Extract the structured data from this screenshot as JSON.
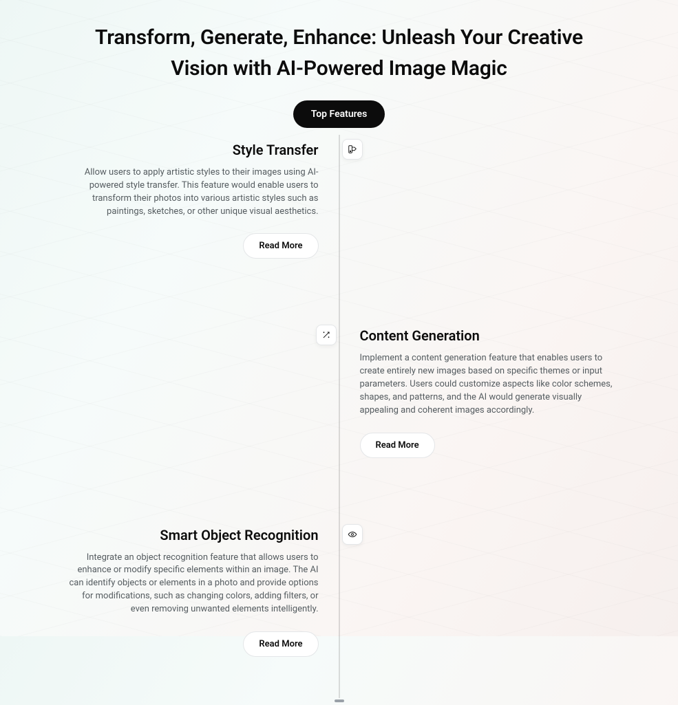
{
  "heading": "Transform, Generate, Enhance: Unleash Your Creative Vision with AI-Powered Image Magic",
  "badge": "Top Features",
  "read_more_label": "Read More",
  "features": [
    {
      "title": "Style Transfer",
      "description": "Allow users to apply artistic styles to their images using AI-powered style transfer. This feature would enable users to transform their photos into various artistic styles such as paintings, sketches, or other unique visual aesthetics.",
      "icon": "palette"
    },
    {
      "title": "Content Generation",
      "description": "Implement a content generation feature that enables users to create entirely new images based on specific themes or input parameters. Users could customize aspects like color schemes, shapes, and patterns, and the AI would generate visually appealing and coherent images accordingly.",
      "icon": "magic-wand"
    },
    {
      "title": "Smart Object Recognition",
      "description": "Integrate an object recognition feature that allows users to enhance or modify specific elements within an image. The AI can identify objects or elements in a photo and provide options for modifications, such as changing colors, adding filters, or even removing unwanted elements intelligently.",
      "icon": "eye"
    }
  ]
}
